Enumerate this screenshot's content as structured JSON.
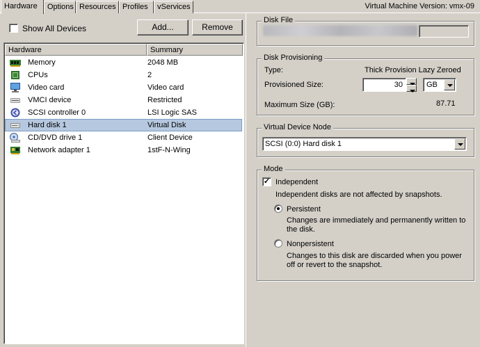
{
  "tabs": [
    {
      "label": "Hardware"
    },
    {
      "label": "Options"
    },
    {
      "label": "Resources"
    },
    {
      "label": "Profiles"
    },
    {
      "label": "vServices"
    }
  ],
  "vm_version": "Virtual Machine Version: vmx-09",
  "left": {
    "show_all_label": "Show All Devices",
    "show_all_checked": false,
    "add_button": "Add...",
    "remove_button": "Remove",
    "columns": {
      "hardware": "Hardware",
      "summary": "Summary"
    },
    "rows": [
      {
        "name": "Memory",
        "summary": "2048 MB",
        "icon": "memory-icon"
      },
      {
        "name": "CPUs",
        "summary": "2",
        "icon": "cpu-icon"
      },
      {
        "name": "Video card",
        "summary": "Video card",
        "icon": "monitor-icon"
      },
      {
        "name": "VMCI device",
        "summary": "Restricted",
        "icon": "vmci-icon"
      },
      {
        "name": "SCSI controller 0",
        "summary": "LSI Logic SAS",
        "icon": "scsi-controller-icon"
      },
      {
        "name": "Hard disk 1",
        "summary": "Virtual Disk",
        "icon": "hard-disk-icon",
        "selected": true
      },
      {
        "name": "CD/DVD drive 1",
        "summary": "Client Device",
        "icon": "cd-drive-icon"
      },
      {
        "name": "Network adapter 1",
        "summary": "1stF-N-Wing",
        "icon": "network-adapter-icon"
      }
    ]
  },
  "right": {
    "disk_file": {
      "title": "Disk File"
    },
    "provisioning": {
      "title": "Disk Provisioning",
      "type_label": "Type:",
      "type_value": "Thick Provision Lazy Zeroed",
      "size_label": "Provisioned Size:",
      "size_value": "30",
      "size_unit": "GB",
      "max_label": "Maximum Size (GB):",
      "max_value": "87.71"
    },
    "device_node": {
      "title": "Virtual Device Node",
      "value": "SCSI (0:0) Hard disk 1"
    },
    "mode": {
      "title": "Mode",
      "independent_label": "Independent",
      "independent_checked": true,
      "independent_desc": "Independent disks are not affected by snapshots.",
      "persistent_label": "Persistent",
      "persistent_desc_1": "Changes are immediately and permanently written to",
      "persistent_desc_2": "the disk.",
      "nonpersistent_label": "Nonpersistent",
      "nonpersistent_desc_1": "Changes to this disk are discarded when you power",
      "nonpersistent_desc_2": "off or revert to the snapshot."
    }
  }
}
